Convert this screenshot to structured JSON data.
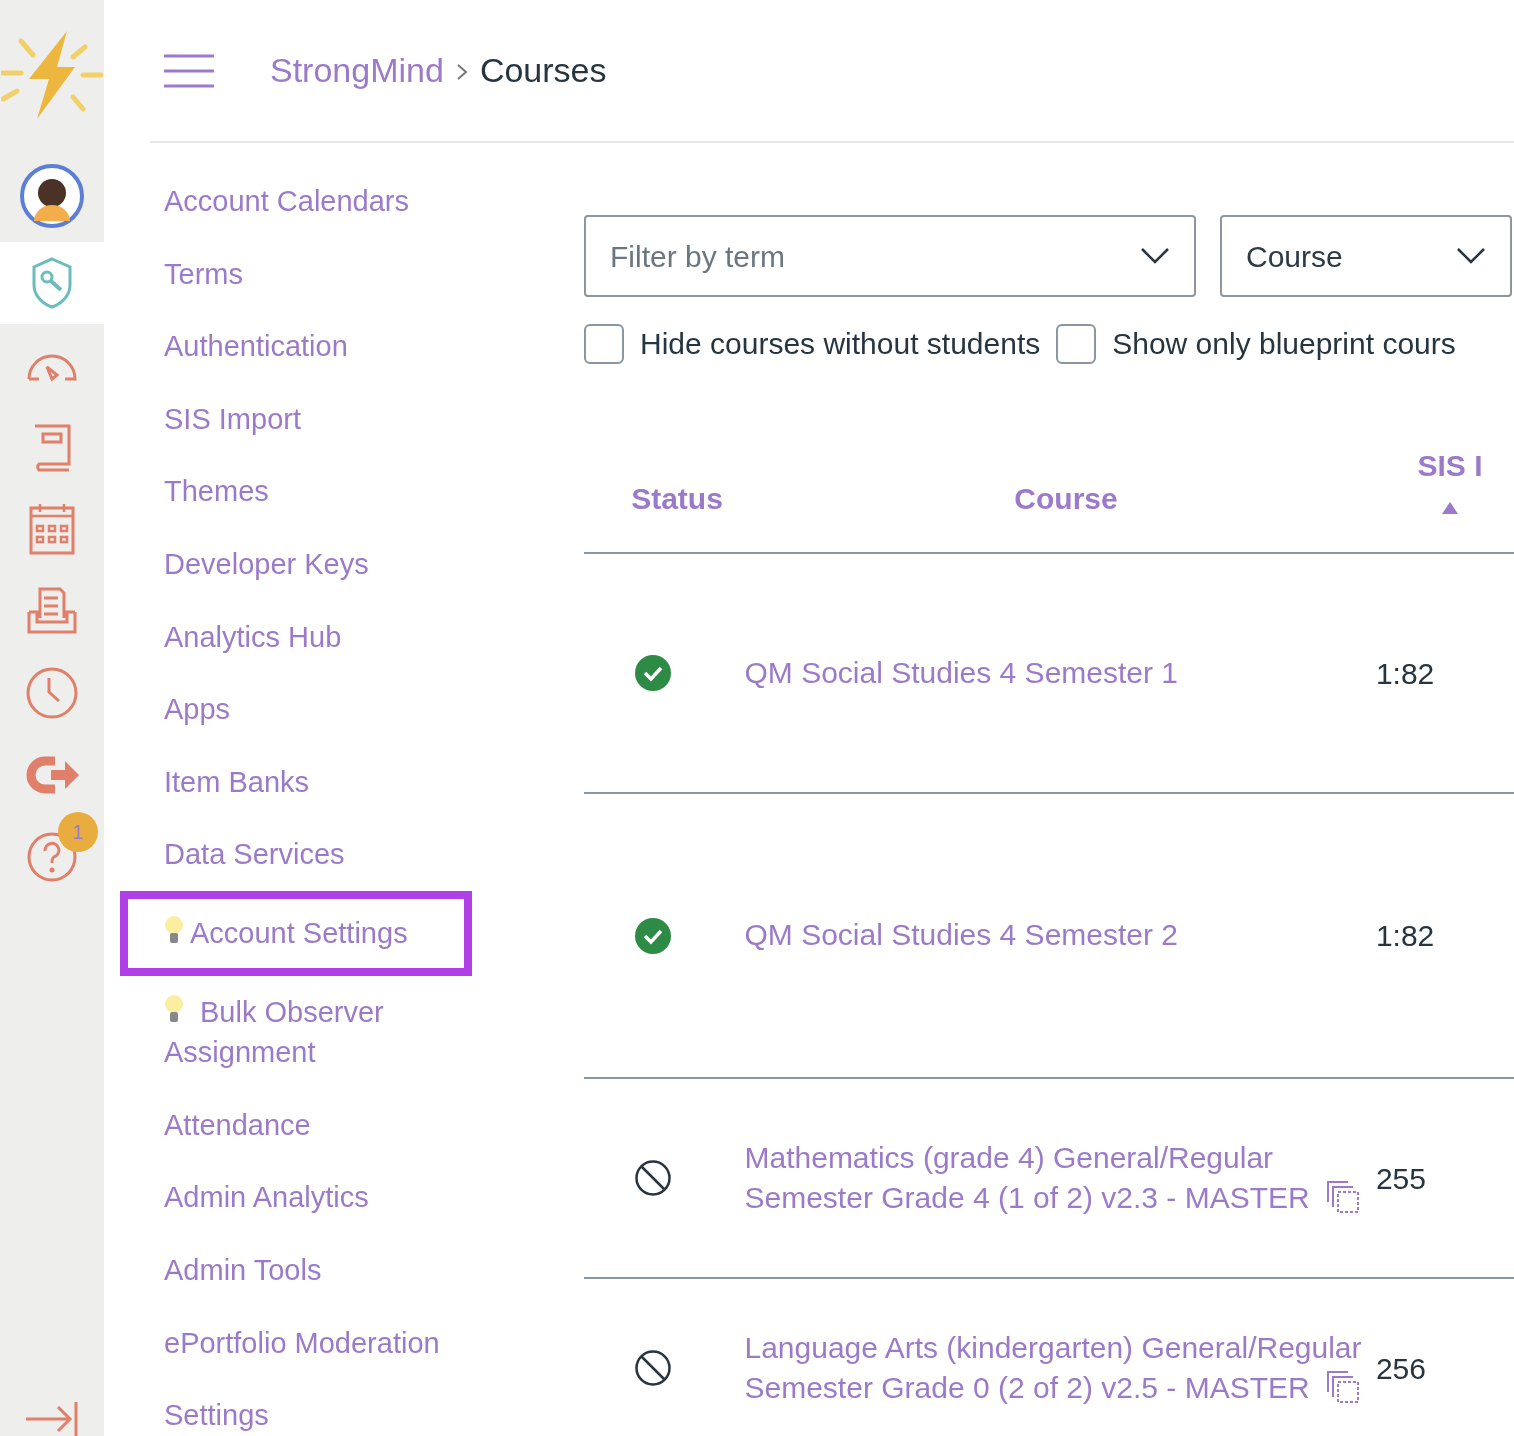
{
  "breadcrumb": [
    {
      "label": "StrongMind",
      "kind": "link"
    },
    {
      "label": "Courses",
      "kind": "current"
    }
  ],
  "rail": [
    {
      "kind": "avatar",
      "selected": false
    },
    {
      "kind": "admin",
      "selected": true
    },
    {
      "kind": "dashboard",
      "selected": false
    },
    {
      "kind": "courses",
      "selected": false
    },
    {
      "kind": "calendar",
      "selected": false
    },
    {
      "kind": "inbox",
      "selected": false
    },
    {
      "kind": "history",
      "selected": false
    },
    {
      "kind": "logout",
      "selected": false
    },
    {
      "kind": "help",
      "selected": false,
      "badge": "1"
    }
  ],
  "nav": [
    {
      "label": "Account Calendars",
      "bulb": false,
      "highlighted": false
    },
    {
      "label": "Terms",
      "bulb": false,
      "highlighted": false
    },
    {
      "label": "Authentication",
      "bulb": false,
      "highlighted": false
    },
    {
      "label": "SIS Import",
      "bulb": false,
      "highlighted": false
    },
    {
      "label": "Themes",
      "bulb": false,
      "highlighted": false
    },
    {
      "label": "Developer Keys",
      "bulb": false,
      "highlighted": false
    },
    {
      "label": "Analytics Hub",
      "bulb": false,
      "highlighted": false
    },
    {
      "label": "Apps",
      "bulb": false,
      "highlighted": false
    },
    {
      "label": "Item Banks",
      "bulb": false,
      "highlighted": false
    },
    {
      "label": "Data Services",
      "bulb": false,
      "highlighted": false
    },
    {
      "label": "Account Settings",
      "bulb": true,
      "highlighted": true
    },
    {
      "label": "Bulk Observer Assignment",
      "bulb": true,
      "highlighted": false
    },
    {
      "label": "Attendance",
      "bulb": false,
      "highlighted": false
    },
    {
      "label": "Admin Analytics",
      "bulb": false,
      "highlighted": false
    },
    {
      "label": "Admin Tools",
      "bulb": false,
      "highlighted": false
    },
    {
      "label": "ePortfolio Moderation",
      "bulb": false,
      "highlighted": false
    },
    {
      "label": "Settings",
      "bulb": false,
      "highlighted": false
    }
  ],
  "filters": {
    "term": {
      "placeholder": "Filter by term"
    },
    "type": {
      "value": "Course"
    }
  },
  "checkboxes": [
    {
      "label": "Hide courses without students",
      "checked": false
    },
    {
      "label": "Show only blueprint cours",
      "checked": false
    }
  ],
  "table": {
    "columns": [
      {
        "label": "Status",
        "sorted": false
      },
      {
        "label": "Course",
        "sorted": false
      },
      {
        "label": "SIS I",
        "sorted": true
      }
    ],
    "rows": [
      {
        "published": true,
        "course": "QM Social Studies 4 Semester 1",
        "blueprint": false,
        "sis_id": "1:82"
      },
      {
        "published": true,
        "course": "QM Social Studies 4 Semester 2",
        "blueprint": false,
        "sis_id": "1:82"
      },
      {
        "published": false,
        "course": "Mathematics (grade 4) General/Regular Semester Grade 4 (1 of 2) v2.3 - MASTER",
        "blueprint": true,
        "sis_id": "255"
      },
      {
        "published": false,
        "course": "Language Arts (kindergarten) General/Regular Semester Grade 0 (2 of 2) v2.5 - MASTER",
        "blueprint": true,
        "sis_id": "256"
      }
    ]
  }
}
